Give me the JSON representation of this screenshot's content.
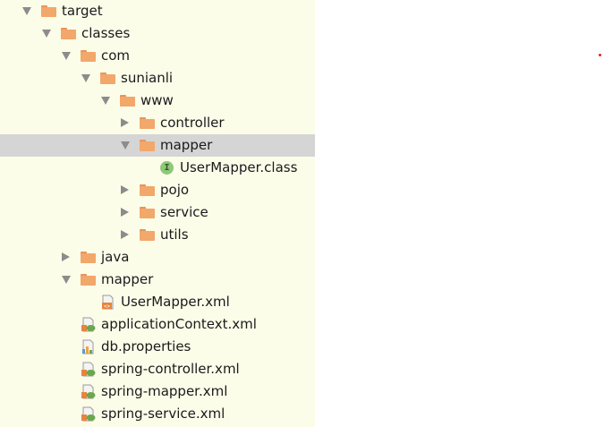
{
  "tree": {
    "nodes": [
      {
        "label": "target",
        "depth": 0,
        "kind": "folder",
        "arrow": "down"
      },
      {
        "label": "classes",
        "depth": 1,
        "kind": "folder",
        "arrow": "down"
      },
      {
        "label": "com",
        "depth": 2,
        "kind": "folder",
        "arrow": "down"
      },
      {
        "label": "sunianli",
        "depth": 3,
        "kind": "folder",
        "arrow": "down"
      },
      {
        "label": "www",
        "depth": 4,
        "kind": "folder",
        "arrow": "down"
      },
      {
        "label": "controller",
        "depth": 5,
        "kind": "folder",
        "arrow": "right"
      },
      {
        "label": "mapper",
        "depth": 5,
        "kind": "folder",
        "arrow": "down",
        "selected": true
      },
      {
        "label": "UserMapper.class",
        "depth": 6,
        "kind": "interface-class",
        "arrow": "none"
      },
      {
        "label": "pojo",
        "depth": 5,
        "kind": "folder",
        "arrow": "right"
      },
      {
        "label": "service",
        "depth": 5,
        "kind": "folder",
        "arrow": "right"
      },
      {
        "label": "utils",
        "depth": 5,
        "kind": "folder",
        "arrow": "right"
      },
      {
        "label": "java",
        "depth": 2,
        "kind": "folder",
        "arrow": "right"
      },
      {
        "label": "mapper",
        "depth": 2,
        "kind": "folder",
        "arrow": "down"
      },
      {
        "label": "UserMapper.xml",
        "depth": 3,
        "kind": "xml-file",
        "arrow": "none"
      },
      {
        "label": "applicationContext.xml",
        "depth": 2,
        "kind": "spring-xml-file",
        "arrow": "none"
      },
      {
        "label": "db.properties",
        "depth": 2,
        "kind": "properties-file",
        "arrow": "none"
      },
      {
        "label": "spring-controller.xml",
        "depth": 2,
        "kind": "spring-xml-file",
        "arrow": "none"
      },
      {
        "label": "spring-mapper.xml",
        "depth": 2,
        "kind": "spring-xml-file",
        "arrow": "none"
      },
      {
        "label": "spring-service.xml",
        "depth": 2,
        "kind": "spring-xml-file",
        "arrow": "none"
      }
    ],
    "icons": {
      "folder": "folder-icon",
      "interface-class": "interface-icon",
      "xml-file": "xml-file-icon",
      "spring-xml-file": "spring-xml-icon",
      "properties-file": "properties-file-icon"
    },
    "interface_letter": "I"
  },
  "colors": {
    "panel_bg": "#fcfde9",
    "selected_bg": "#d5d5d5",
    "folder": "#f2a76b",
    "folder_tab": "#e8955a",
    "interface_icon": "#8fc87a",
    "xml_orange": "#e8843c",
    "spring_green": "#6aa84f",
    "arrow": "#8c8c8c"
  }
}
